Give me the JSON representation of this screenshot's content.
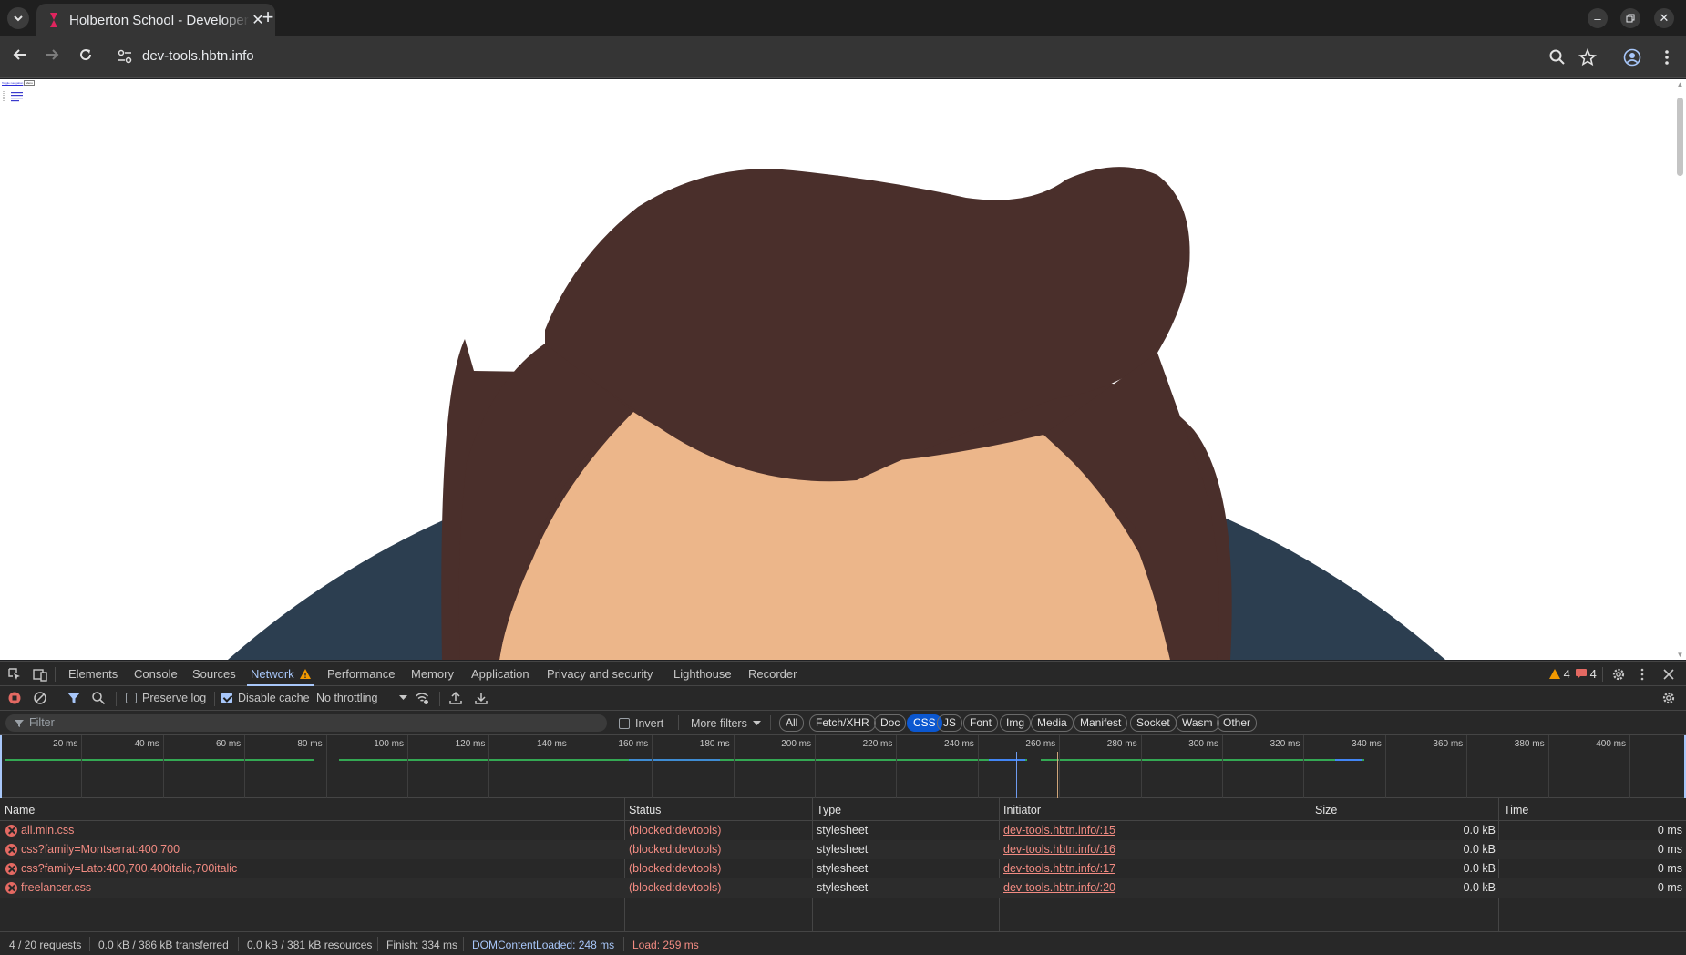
{
  "tab": {
    "title": "Holberton School - Developer tools"
  },
  "address_bar": {
    "url": "dev-tools.hbtn.info"
  },
  "page": {
    "tiny_link_text": "Toggle navigation",
    "tiny_button_text": "Menu"
  },
  "devtools": {
    "tabs": [
      "Elements",
      "Console",
      "Sources",
      "Network",
      "Performance",
      "Memory",
      "Application",
      "Privacy and security",
      "Lighthouse",
      "Recorder"
    ],
    "active_tab": "Network",
    "warning_count": "4",
    "issue_count": "4",
    "toolbar": {
      "preserve_log": "Preserve log",
      "disable_cache": "Disable cache",
      "throttling": "No throttling"
    },
    "filter": {
      "placeholder": "Filter",
      "invert": "Invert",
      "more_filters": "More filters",
      "types": [
        "All",
        "Fetch/XHR",
        "Doc",
        "CSS",
        "JS",
        "Font",
        "Img",
        "Media",
        "Manifest",
        "Socket",
        "Wasm",
        "Other"
      ],
      "active_type": "CSS"
    },
    "overview": {
      "ticks": [
        "20 ms",
        "40 ms",
        "60 ms",
        "80 ms",
        "100 ms",
        "120 ms",
        "140 ms",
        "160 ms",
        "180 ms",
        "200 ms",
        "220 ms",
        "240 ms",
        "260 ms",
        "280 ms",
        "300 ms",
        "320 ms",
        "340 ms",
        "360 ms",
        "380 ms",
        "400 ms"
      ]
    },
    "columns": [
      "Name",
      "Status",
      "Type",
      "Initiator",
      "Size",
      "Time"
    ],
    "requests": [
      {
        "name": "all.min.css",
        "status": "(blocked:devtools)",
        "type": "stylesheet",
        "initiator": "dev-tools.hbtn.info/:15",
        "size": "0.0 kB",
        "time": "0 ms"
      },
      {
        "name": "css?family=Montserrat:400,700",
        "status": "(blocked:devtools)",
        "type": "stylesheet",
        "initiator": "dev-tools.hbtn.info/:16",
        "size": "0.0 kB",
        "time": "0 ms"
      },
      {
        "name": "css?family=Lato:400,700,400italic,700italic",
        "status": "(blocked:devtools)",
        "type": "stylesheet",
        "initiator": "dev-tools.hbtn.info/:17",
        "size": "0.0 kB",
        "time": "0 ms"
      },
      {
        "name": "freelancer.css",
        "status": "(blocked:devtools)",
        "type": "stylesheet",
        "initiator": "dev-tools.hbtn.info/:20",
        "size": "0.0 kB",
        "time": "0 ms"
      }
    ],
    "status_bar": {
      "requests": "4 / 20 requests",
      "transferred": "0.0 kB / 386 kB transferred",
      "resources": "0.0 kB / 381 kB resources",
      "finish": "Finish: 334 ms",
      "dom_content_loaded": "DOMContentLoaded: 248 ms",
      "load": "Load: 259 ms"
    }
  },
  "colors": {
    "hair": "#4a2f2b",
    "skin": "#ecb68a",
    "shirt": "#2c3e50",
    "accent": "#a8c7fa",
    "error": "#f28b82"
  }
}
